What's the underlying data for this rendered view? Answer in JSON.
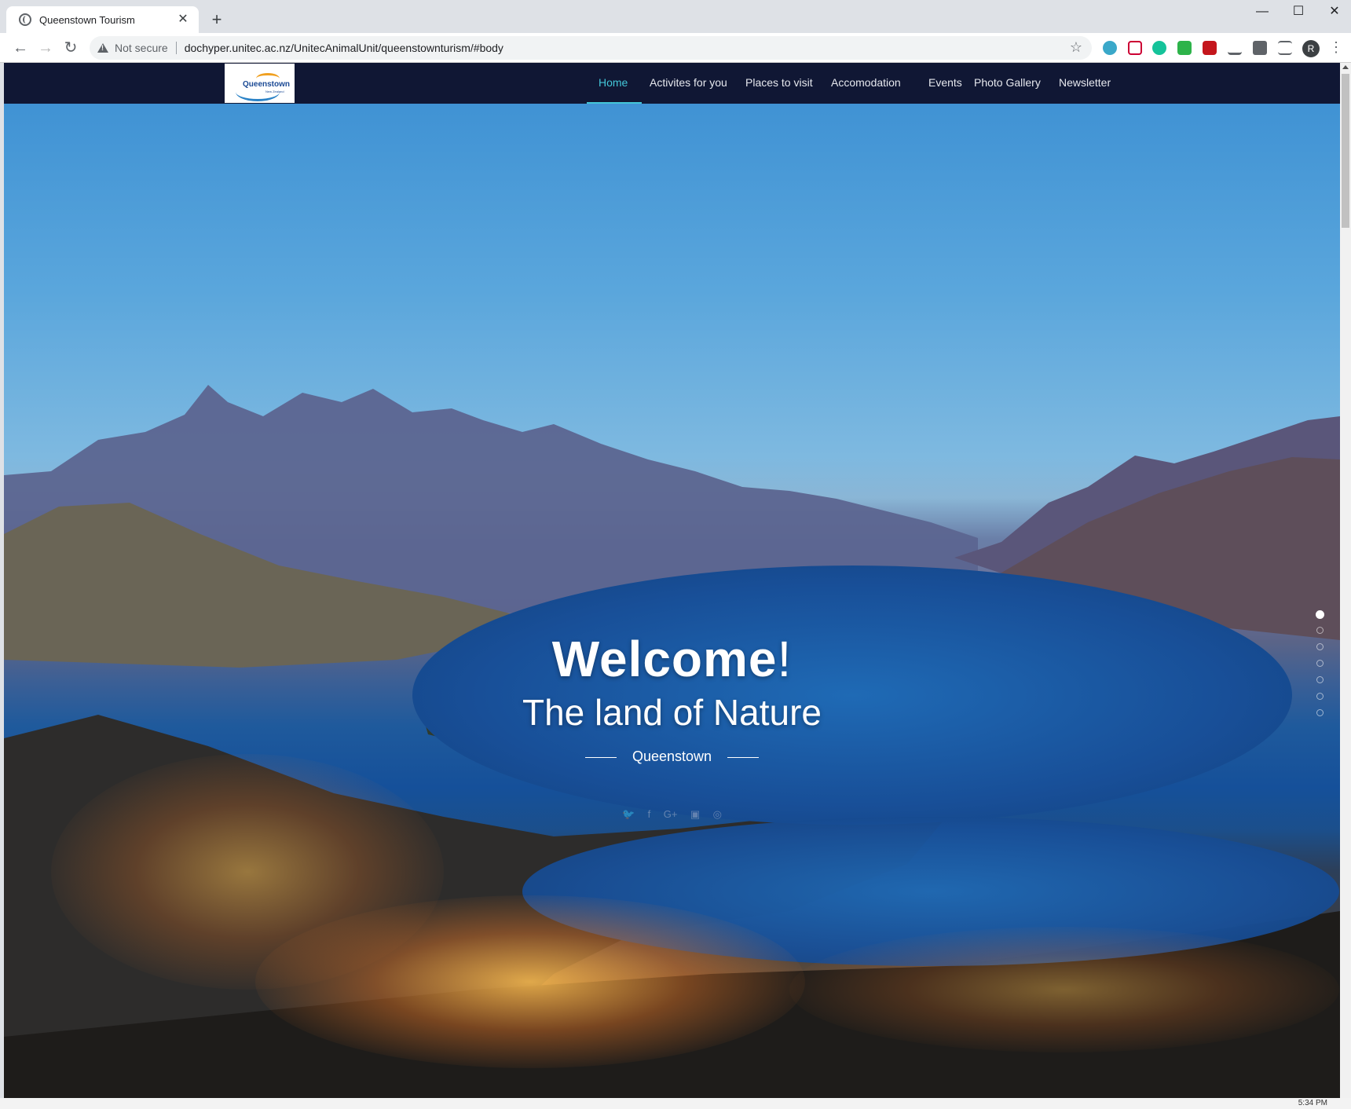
{
  "browser": {
    "tab_title": "Queenstown Tourism",
    "tab_close": "✕",
    "new_tab": "+",
    "minimize": "—",
    "maximize": "☐",
    "close": "✕",
    "back": "←",
    "forward": "→",
    "reload": "↻",
    "security_label": "Not secure",
    "url": "dochyper.unitec.ac.nz/UnitecAnimalUnit/queenstownturism/#body",
    "bookmark_star": "☆",
    "profile_initial": "R",
    "menu_dots": "⋮"
  },
  "site": {
    "logo": {
      "title": "Queenstown",
      "subtitle": "New Zealand"
    },
    "nav": [
      {
        "label": "Home",
        "active": true
      },
      {
        "label": "Activites for you",
        "active": false
      },
      {
        "label": "Places to visit",
        "active": false
      },
      {
        "label": "Accomodation",
        "active": false
      },
      {
        "label": "Events",
        "active": false
      },
      {
        "label": "Photo Gallery",
        "active": false
      },
      {
        "label": "Newsletter",
        "active": false
      }
    ],
    "hero": {
      "welcome": "Welcome",
      "welcome_punct": "!",
      "tagline": "The land of Nature",
      "subline": "Queenstown"
    },
    "social_icons": [
      "twitter-icon",
      "facebook-icon",
      "google-plus-icon",
      "youtube-icon",
      "instagram-icon"
    ],
    "social_glyphs": [
      "🐦",
      "f",
      "G+",
      "▣",
      "◎"
    ],
    "slider": {
      "count": 7,
      "active_index": 0
    }
  },
  "taskbar": {
    "clock": "5:34 PM"
  },
  "colors": {
    "navbar": "#101734",
    "accent": "#43c6d8"
  }
}
